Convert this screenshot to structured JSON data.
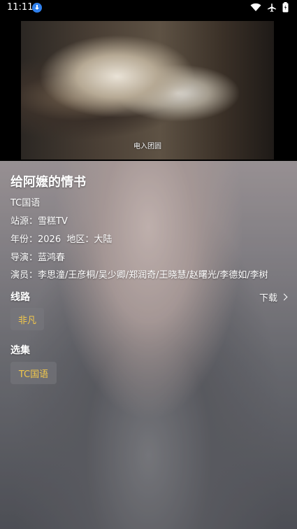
{
  "status_bar": {
    "time": "11:11"
  },
  "player": {
    "subtitle": "电入团圆"
  },
  "detail": {
    "title": "给阿嬷的情书",
    "remark": "TC国语",
    "source_label": "站源：",
    "source_value": "雪糕TV",
    "year_label": "年份：",
    "year_value": "2026",
    "region_label": "地区：",
    "region_value": "大陆",
    "director_label": "导演：",
    "director_value": "蓝鸿春",
    "cast_label": "演员：",
    "cast_value": "李思潼/王彦桐/吴少卿/郑润奇/王晓慧/赵曙光/李德如/李树"
  },
  "lines": {
    "label": "线路",
    "download_label": "下载",
    "items": [
      "非凡"
    ]
  },
  "episodes": {
    "label": "选集",
    "items": [
      "TC国语"
    ]
  },
  "colors": {
    "chip_text": "#f2c84b",
    "status_download": "#2f80ed"
  },
  "icons": [
    "download-status-icon",
    "wifi-icon",
    "airplane-icon",
    "battery-icon",
    "chevron-right-icon"
  ]
}
